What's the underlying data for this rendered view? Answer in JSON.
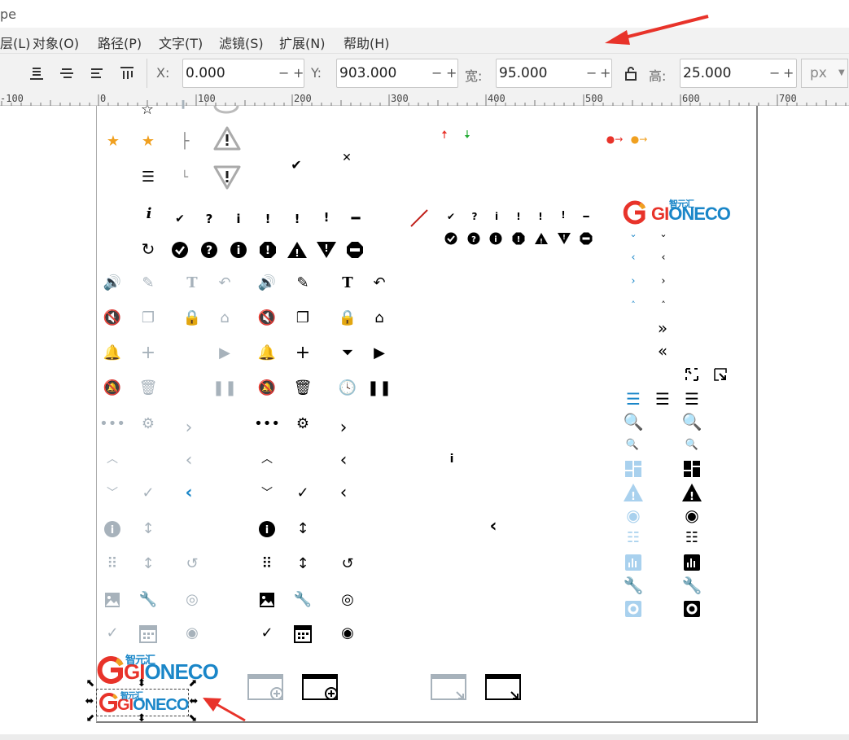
{
  "window": {
    "title": "pe"
  },
  "menu": [
    "层(L)",
    "对象(O)",
    "路径(P)",
    "文字(T)",
    "滤镜(S)",
    "扩展(N)",
    "帮助(H)"
  ],
  "toolbar": {
    "x_label": "X:",
    "x_value": "0.000",
    "y_label": "Y:",
    "y_value": "903.000",
    "w_label": "宽:",
    "w_value": "95.000",
    "h_label": "高:",
    "h_value": "25.000",
    "unit": "px",
    "minus": "−",
    "plus": "+"
  },
  "ruler": [
    "-100",
    "0",
    "100",
    "200",
    "300",
    "400",
    "500",
    "600",
    "700"
  ],
  "logo": {
    "brand_cn": "智元汇",
    "brand_left": "GI",
    "brand_right": "ONECO"
  },
  "colors": {
    "accent_blue": "#1a86c8",
    "gray_icon": "#a7b2bb",
    "red": "#e8332a",
    "orange": "#f0a020",
    "annotation_red": "#e8332a"
  }
}
